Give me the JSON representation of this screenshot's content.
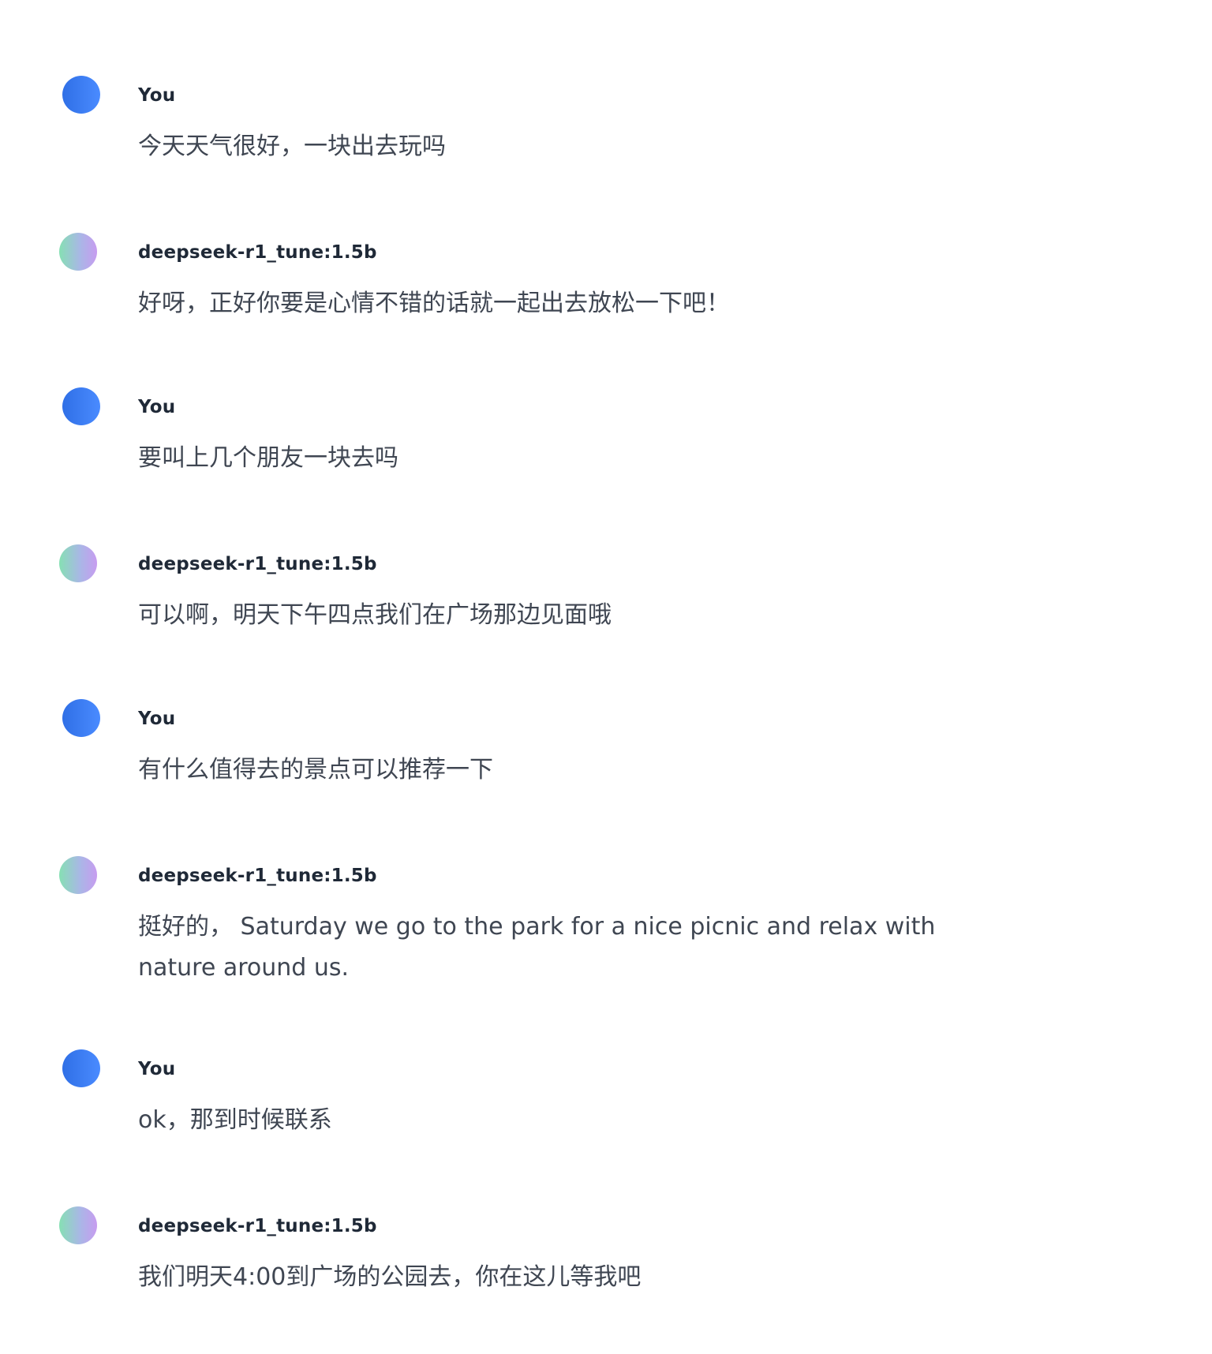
{
  "messages": [
    {
      "role": "user",
      "author": "You",
      "text": "今天天气很好，一块出去玩吗"
    },
    {
      "role": "assistant",
      "author": "deepseek-r1_tune:1.5b",
      "text": "好呀，正好你要是心情不错的话就一起出去放松一下吧！"
    },
    {
      "role": "user",
      "author": "You",
      "text": "要叫上几个朋友一块去吗"
    },
    {
      "role": "assistant",
      "author": "deepseek-r1_tune:1.5b",
      "text": "可以啊，明天下午四点我们在广场那边见面哦"
    },
    {
      "role": "user",
      "author": "You",
      "text": "有什么值得去的景点可以推荐一下"
    },
    {
      "role": "assistant",
      "author": "deepseek-r1_tune:1.5b",
      "text": "挺好的， Saturday we go to the park for a nice picnic and relax with nature around us."
    },
    {
      "role": "user",
      "author": "You",
      "text": "ok，那到时候联系"
    },
    {
      "role": "assistant",
      "author": "deepseek-r1_tune:1.5b",
      "text": "我们明天4:00到广场的公园去，你在这儿等我吧"
    }
  ],
  "colors": {
    "user_avatar": "#3b7cf5",
    "assistant_avatar_start": "#86e0b3",
    "assistant_avatar_end": "#c79cf0",
    "text": "#3f4652",
    "name": "#1f2937"
  },
  "icons": {
    "user_avatar": "user-avatar-icon",
    "assistant_avatar": "assistant-avatar-icon"
  }
}
